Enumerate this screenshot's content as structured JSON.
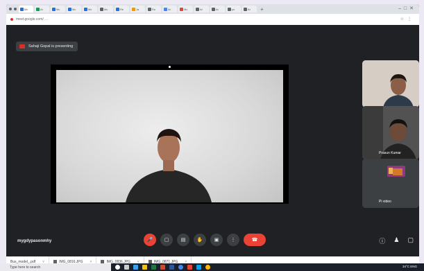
{
  "browser": {
    "tabs": [
      {
        "label": "Mc",
        "color": "#1a73e8"
      },
      {
        "label": "Ar",
        "color": "#0f9d58"
      },
      {
        "label": "Mc",
        "color": "#1a73e8"
      },
      {
        "label": "Mc",
        "color": "#1a73e8"
      },
      {
        "label": "Mc",
        "color": "#1a73e8"
      },
      {
        "label": "Mc",
        "color": "#5f6368"
      },
      {
        "label": "Re",
        "color": "#1a73e8"
      },
      {
        "label": "Ja",
        "color": "#f29900"
      },
      {
        "label": "Ru",
        "color": "#5f6368"
      },
      {
        "label": "Ar",
        "color": "#4285f4"
      },
      {
        "label": "Mc",
        "color": "#ea4335"
      },
      {
        "label": "Ar",
        "color": "#5f6368"
      },
      {
        "label": "Ar",
        "color": "#5f6368"
      },
      {
        "label": "yo",
        "color": "#5f6368"
      },
      {
        "label": "Ar",
        "color": "#5f6368"
      }
    ],
    "url": "meet.google.com/ …"
  },
  "meet": {
    "presenting_text": "Sahaji Gopal is presenting",
    "meeting_code": "mygdypasonmhy",
    "participants": [
      {
        "name": ""
      },
      {
        "name": "Prasun Kumar"
      },
      {
        "name": "Pi video"
      }
    ]
  },
  "downloads": [
    {
      "label": "Bus_model_.pdf"
    },
    {
      "label": "IMG_0816.JPG"
    },
    {
      "label": "IMG_0836.JPG"
    },
    {
      "label": "IMG_0871.JPG"
    }
  ],
  "taskbar": {
    "search_placeholder": "Type here to search",
    "tray_text": "34°C  ENG"
  }
}
